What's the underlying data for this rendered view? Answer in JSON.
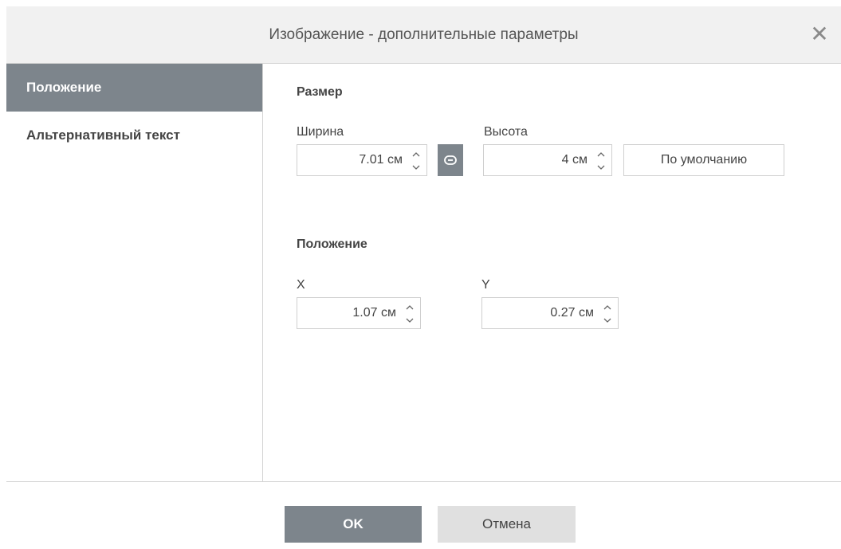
{
  "dialog": {
    "title": "Изображение - дополнительные параметры",
    "close_symbol": "✕"
  },
  "sidebar": {
    "items": [
      {
        "label": "Положение",
        "active": true
      },
      {
        "label": "Альтернативный текст",
        "active": false
      }
    ]
  },
  "size_section": {
    "title": "Размер",
    "width_label": "Ширина",
    "width_value": "7.01 см",
    "height_label": "Высота",
    "height_value": "4 см",
    "lock_icon": "link-icon",
    "default_button": "По умолчанию"
  },
  "position_section": {
    "title": "Положение",
    "x_label": "X",
    "x_value": "1.07 см",
    "y_label": "Y",
    "y_value": "0.27 см"
  },
  "footer": {
    "ok_label": "OK",
    "cancel_label": "Отмена"
  },
  "colors": {
    "accent": "#7d858c",
    "titlebar_bg": "#f1f1f1",
    "cancel_bg": "#e0e0e0",
    "border": "#cfcfcf"
  }
}
